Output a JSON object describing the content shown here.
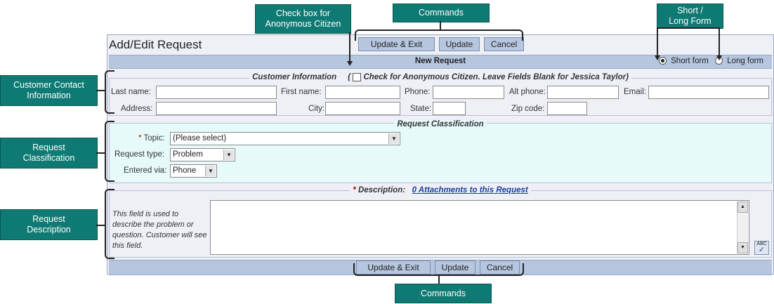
{
  "callouts": {
    "anonymous": "Check box for\nAnonymous Citizen",
    "commands_top": "Commands",
    "short_long": "Short /\nLong Form",
    "customer_contact": "Customer Contact\nInformation",
    "request_classification": "Request\nClassification",
    "request_description": "Request\nDescription",
    "commands_bottom": "Commands"
  },
  "window": {
    "title": "Add/Edit Request"
  },
  "commands": {
    "update_exit": "Update & Exit",
    "update": "Update",
    "cancel": "Cancel"
  },
  "header_bar": {
    "title": "New Request",
    "short_form": "Short form",
    "long_form": "Long form",
    "selected": "short"
  },
  "customer": {
    "legend": "Customer Information",
    "anon_text": "Check for Anonymous Citizen. Leave Fields Blank for Jessica Taylor)",
    "open_paren": "(",
    "last_name": "Last name:",
    "first_name": "First name:",
    "phone": "Phone:",
    "alt_phone": "Alt phone:",
    "email": "Email:",
    "address": "Address:",
    "city": "City:",
    "state": "State:",
    "zip": "Zip code:"
  },
  "classification": {
    "legend": "Request Classification",
    "topic_label": "Topic:",
    "topic_value": "(Please select)",
    "type_label": "Request type:",
    "type_value": "Problem",
    "via_label": "Entered via:",
    "via_value": "Phone"
  },
  "description": {
    "required_mark": "*",
    "label": "Description:",
    "attachments": "0 Attachments to this Request",
    "help": "This field is used to describe the problem or question. Customer will see this field.",
    "value": ""
  },
  "colors": {
    "callout": "#0f7a73",
    "bar": "#b6c6de",
    "classification_bg": "#e6fafa",
    "link": "#1a3fa0",
    "required": "#c00000"
  }
}
